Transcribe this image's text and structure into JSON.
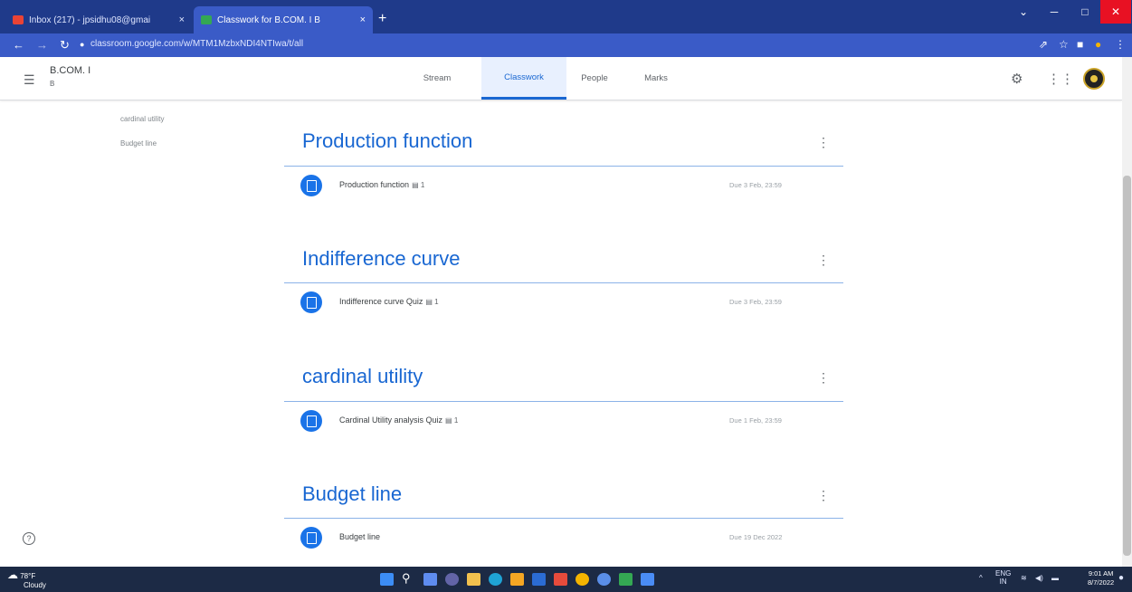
{
  "browser": {
    "tabs": [
      {
        "label": "Inbox (217) - jpsidhu08@gmai",
        "close": "×"
      },
      {
        "label": "Classwork for B.COM. I B",
        "close": "×"
      }
    ],
    "new_tab": "+",
    "url": "classroom.google.com/w/MTM1MzbxNDI4NTIwa/t/all",
    "window_controls": {
      "minimize": "─",
      "maximize": "□",
      "close": "✕"
    }
  },
  "header": {
    "class_title": "B.COM. I",
    "class_section": "B",
    "tabs": [
      "Stream",
      "Classwork",
      "People",
      "Marks"
    ],
    "active_tab": "Classwork"
  },
  "sidebar_topics": [
    "cardinal utility",
    "Budget line"
  ],
  "topics": [
    {
      "title": "Production function",
      "items": [
        {
          "name": "Production function",
          "count": "1",
          "due": "Due 3 Feb, 23:59"
        }
      ]
    },
    {
      "title": "Indifference curve",
      "items": [
        {
          "name": "Indifference curve Quiz",
          "count": "1",
          "due": "Due 3 Feb, 23:59"
        }
      ]
    },
    {
      "title": "cardinal utility",
      "items": [
        {
          "name": "Cardinal Utility analysis Quiz",
          "count": "1",
          "due": "Due 1 Feb, 23:59"
        }
      ]
    },
    {
      "title": "Budget line",
      "items": [
        {
          "name": "Budget line",
          "count": "",
          "due": "Due 19 Dec 2022"
        }
      ]
    }
  ],
  "taskbar": {
    "weather_temp": "78°F",
    "weather_desc": "Cloudy",
    "lang": "ENG",
    "lang_region": "IN",
    "time": "9:01 AM",
    "date": "8/7/2022"
  },
  "colors": {
    "accent": "#1967d2",
    "chrome": "#1f3a8a"
  }
}
